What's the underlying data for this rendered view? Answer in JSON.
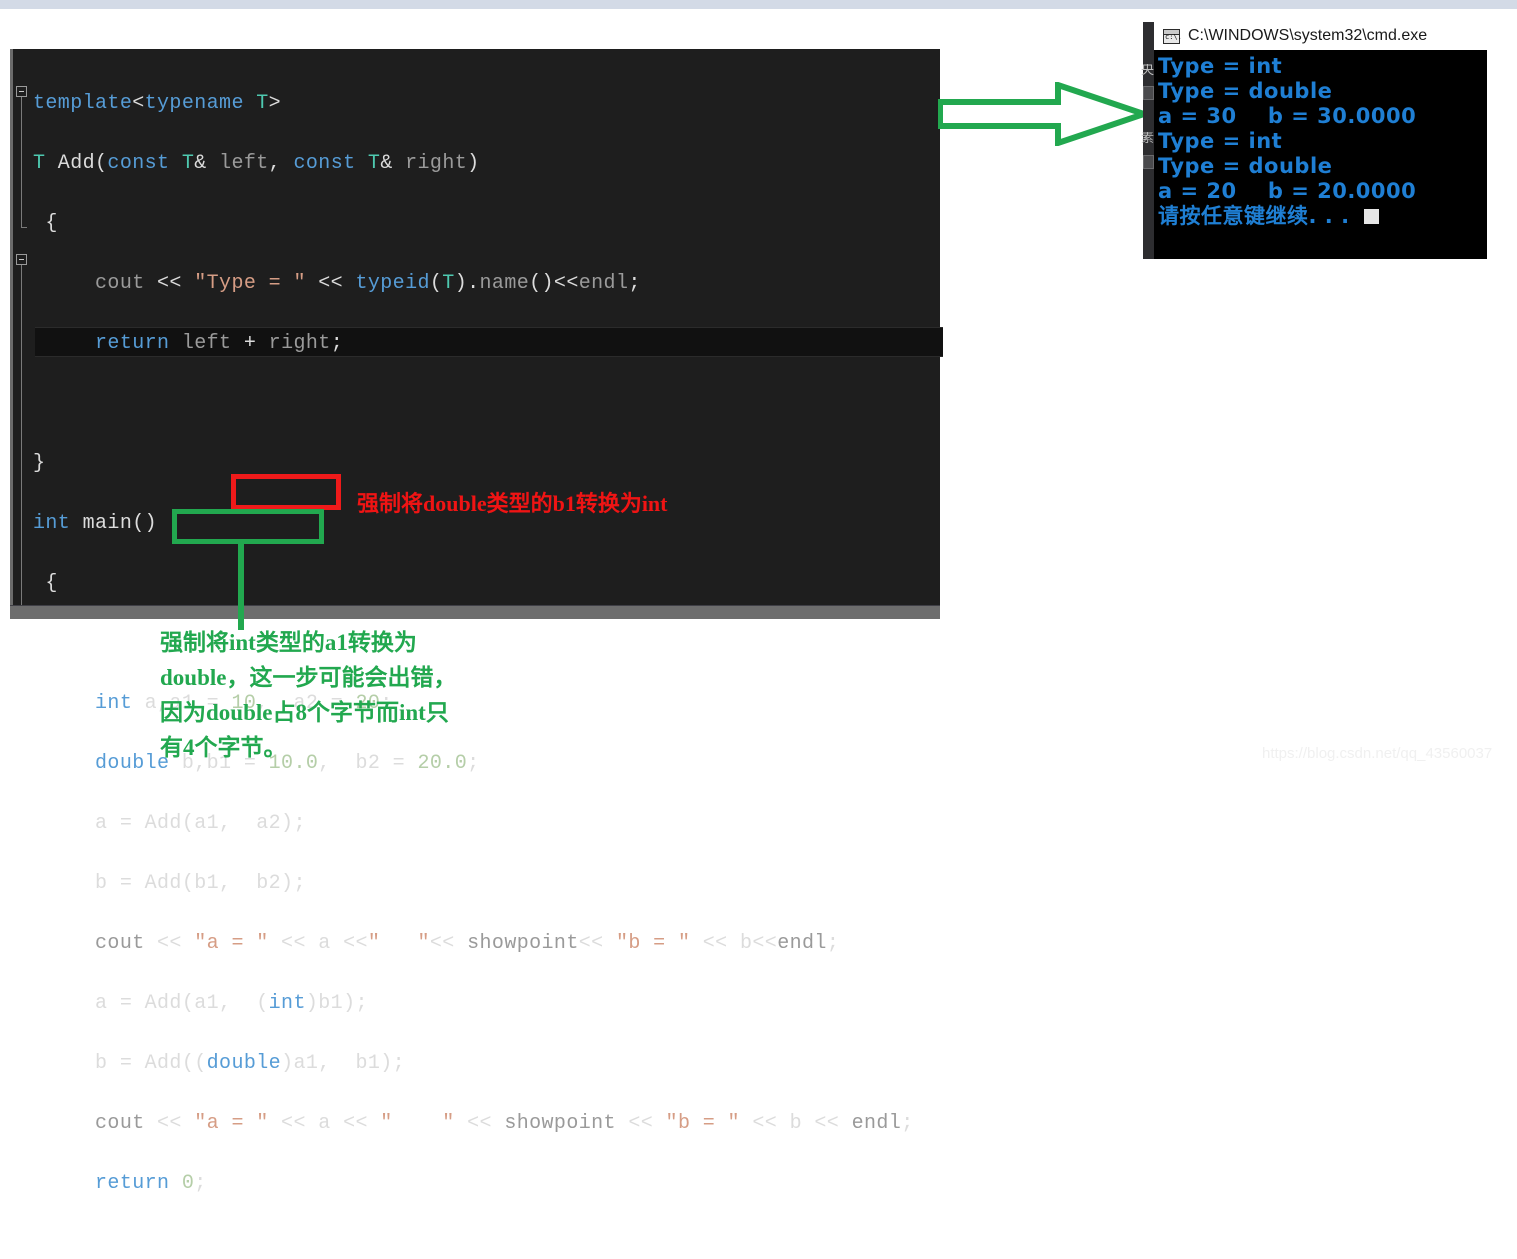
{
  "editor": {
    "name": "visual-studio-code-editor",
    "background": "#1e1e1e",
    "lines": [
      "template<typename T>",
      "T Add(const T& left, const T& right)",
      "{",
      "",
      "    cout << \"Type = \" << typeid(T).name()<<endl;",
      "    return left + right;",
      "",
      "}",
      "int main()",
      "{",
      "",
      "    int a,a1 = 10,  a2 = 20;",
      "    double b,b1 = 10.0,  b2 = 20.0;",
      "    a = Add(a1,  a2);",
      "    b = Add(b1,  b2);",
      "    cout << \"a = \" << a <<\"   \"<< showpoint<< \"b = \" << b<<endl;",
      "    a = Add(a1,  (int)b1);",
      "    b = Add((double)a1,  b1);",
      "    cout << \"a = \" << a << \"    \" << showpoint << \"b = \" << b << endl;",
      "    return 0;"
    ]
  },
  "annotations": {
    "red_box_label": "cast-to-int-highlight",
    "green_box_label": "cast-to-double-highlight",
    "red_note": "强制将double类型的b1转换为int",
    "green_note": "强制将int类型的a1转换为\ndouble，这一步可能会出错，\n因为double占8个字节而int只\n有4个字节。",
    "red_color": "#ef1a1a",
    "green_color": "#22a84f"
  },
  "arrow": {
    "name": "green-right-arrow",
    "color": "#22a84f"
  },
  "console": {
    "title": "C:\\WINDOWS\\system32\\cmd.exe",
    "icon": "cmd-icon",
    "text_color": "#1f7fd4",
    "lines": [
      "Type = int",
      "Type = double",
      "a = 30    b = 30.0000",
      "Type = int",
      "Type = double",
      "a = 20    b = 20.0000",
      "请按任意键继续. . ."
    ],
    "side_fragments": [
      "央",
      "素"
    ]
  },
  "watermark": {
    "text": "https://blog.csdn.net/qq_43560037"
  }
}
